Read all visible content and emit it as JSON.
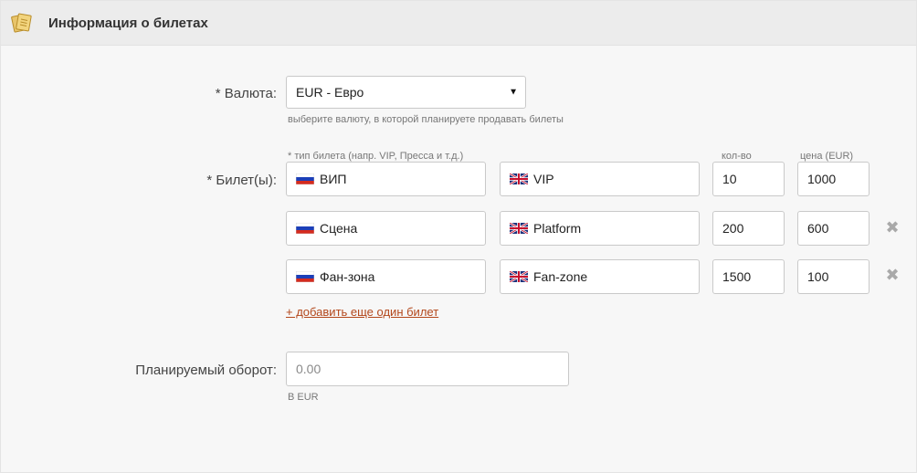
{
  "header": {
    "title": "Информация о билетах",
    "icon": "tickets-icon"
  },
  "currency": {
    "label": "* Валюта:",
    "selected": "EUR - Евро",
    "hint": "выберите валюту, в которой планируете продавать билеты"
  },
  "tickets": {
    "label": "* Билет(ы):",
    "type_header": "* тип билета (напр. VIP, Пресса и т.д.)",
    "qty_header": "кол-во",
    "price_header": "цена (EUR)",
    "rows": [
      {
        "name_ru": "ВИП",
        "name_en": "VIP",
        "qty": "10",
        "price": "1000",
        "removable": false
      },
      {
        "name_ru": "Сцена",
        "name_en": "Platform",
        "qty": "200",
        "price": "600",
        "removable": true
      },
      {
        "name_ru": "Фан-зона",
        "name_en": "Fan-zone",
        "qty": "1500",
        "price": "100",
        "removable": true
      }
    ],
    "add_link": "+ добавить еще один билет",
    "remove_symbol": "✖"
  },
  "turnover": {
    "label": "Планируемый оборот:",
    "placeholder": "0.00",
    "hint": "В EUR"
  },
  "colors": {
    "link": "#b3471b",
    "field_border": "#c9c9c9",
    "background": "#f7f7f7"
  }
}
